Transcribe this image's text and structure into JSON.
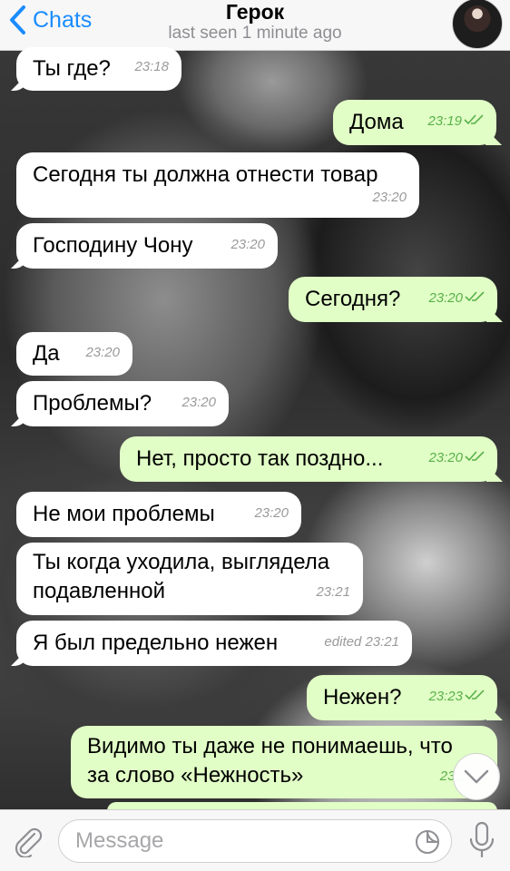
{
  "header": {
    "back_label": "Chats",
    "title": "Герок",
    "status": "last seen 1 minute ago"
  },
  "messages": [
    {
      "dir": "in",
      "text": "Ты где?",
      "time": "23:18"
    },
    {
      "dir": "out",
      "text": "Дома",
      "time": "23:19"
    },
    {
      "dir": "in",
      "text": "Сегодня ты должна отнести товар",
      "time": "23:20"
    },
    {
      "dir": "in",
      "text": "Господину Чону",
      "time": "23:20"
    },
    {
      "dir": "out",
      "text": "Сегодня?",
      "time": "23:20"
    },
    {
      "dir": "in",
      "text": "Да",
      "time": "23:20"
    },
    {
      "dir": "in",
      "text": "Проблемы?",
      "time": "23:20"
    },
    {
      "dir": "out",
      "text": "Нет, просто так поздно...",
      "time": "23:20"
    },
    {
      "dir": "in",
      "text": "Не мои проблемы",
      "time": "23:20"
    },
    {
      "dir": "in",
      "text_line1": "Ты когда уходила, выглядела",
      "text_line2": "подавленной",
      "time": "23:21"
    },
    {
      "dir": "in",
      "text": "Я был предельно нежен",
      "time": "edited 23:21"
    },
    {
      "dir": "out",
      "text": "Нежен?",
      "time": "23:23"
    },
    {
      "dir": "out",
      "text_line1": "Видимо ты даже не понимаешь, что",
      "text_line2": "за слово «Нежность»",
      "time": "23:2"
    }
  ],
  "input": {
    "placeholder": "Message"
  },
  "icons": {
    "back": "chevron-left-icon",
    "attach": "paperclip-icon",
    "sticker": "sticker-icon",
    "mic": "microphone-icon",
    "scroll": "chevron-down-icon",
    "read": "double-check-icon"
  },
  "colors": {
    "accent": "#1a8cff",
    "incoming_bubble": "#ffffff",
    "outgoing_bubble": "#e1fec6",
    "outgoing_meta": "#59b04a"
  }
}
